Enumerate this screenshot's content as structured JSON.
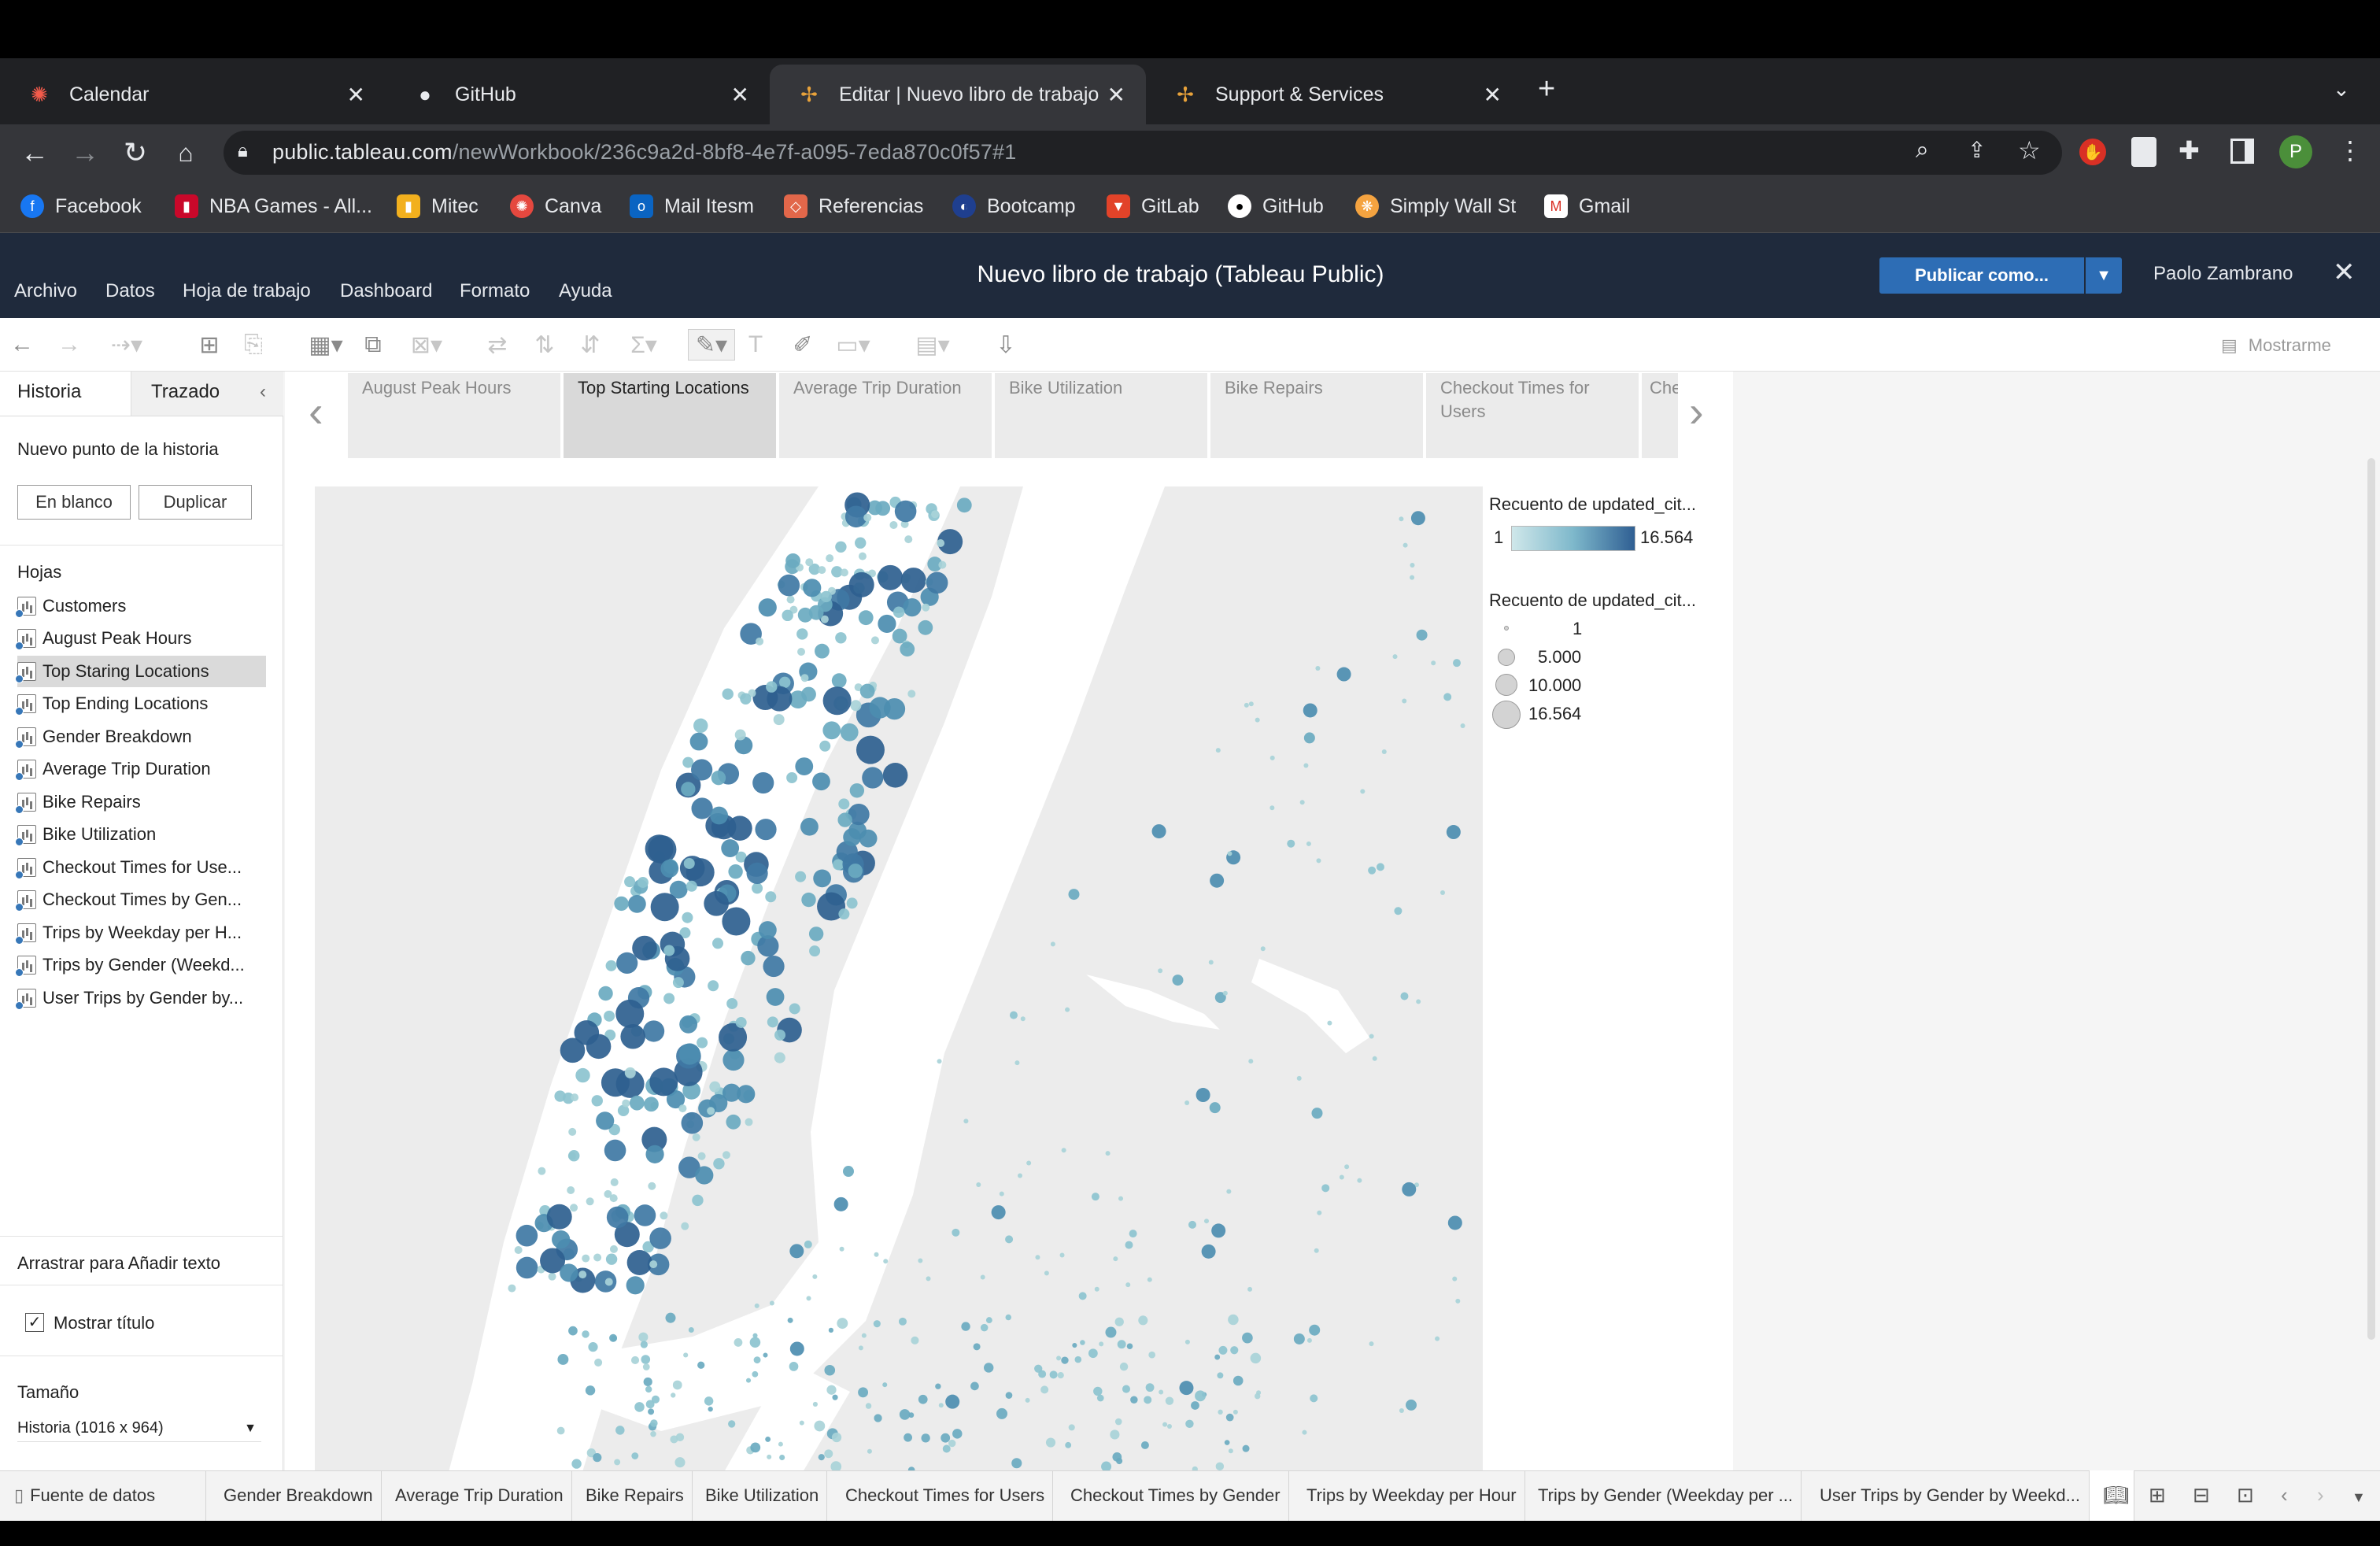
{
  "browser": {
    "tabs": [
      {
        "title": "Calendar",
        "icon": "calendar-icon"
      },
      {
        "title": "GitHub",
        "icon": "github-icon"
      },
      {
        "title": "Editar | Nuevo libro de trabajo",
        "icon": "tableau-icon"
      },
      {
        "title": "Support & Services",
        "icon": "tableau-icon"
      }
    ],
    "url_domain": "public.tableau.com",
    "url_path": "/newWorkbook/236c9a2d-8bf8-4e7f-a095-7eda870c0f57#1",
    "profile_initial": "P",
    "bookmarks": [
      "Facebook",
      "NBA Games - All...",
      "Mitec",
      "Canva",
      "Mail Itesm",
      "Referencias",
      "Bootcamp",
      "GitLab",
      "GitHub",
      "Simply Wall St",
      "Gmail"
    ]
  },
  "tableau": {
    "menu": [
      "Archivo",
      "Datos",
      "Hoja de trabajo",
      "Dashboard",
      "Formato",
      "Ayuda"
    ],
    "workbook_title": "Nuevo libro de trabajo (Tableau Public)",
    "publish_label": "Publicar como...",
    "user_name": "Paolo Zambrano",
    "show_me": "Mostrarme"
  },
  "left_panel": {
    "tab_history": "Historia",
    "tab_layout": "Trazado",
    "new_story_point": "Nuevo punto de la historia",
    "btn_blank": "En blanco",
    "btn_duplicate": "Duplicar",
    "sheets_header": "Hojas",
    "sheets": [
      "Customers",
      "August Peak Hours",
      "Top Staring Locations",
      "Top Ending Locations",
      "Gender Breakdown",
      "Average Trip Duration",
      "Bike Repairs",
      "Bike Utilization",
      "Checkout Times for Use...",
      "Checkout Times by Gen...",
      "Trips by Weekday per H...",
      "Trips by Gender (Weekd...",
      "User Trips by Gender by..."
    ],
    "selected_sheet": "Top Staring Locations",
    "drag_text": "Arrastrar para Añadir texto",
    "show_title": "Mostrar título",
    "size_header": "Tamaño",
    "size_value": "Historia (1016 x 964)"
  },
  "story_points": [
    "August Peak Hours",
    "Top Starting Locations",
    "Average Trip Duration",
    "Bike Utilization",
    "Bike Repairs",
    "Checkout Times for Users",
    "Checkout Times by Gender"
  ],
  "selected_story_point": "Top Starting Locations",
  "legend": {
    "color_title": "Recuento de updated_cit...",
    "color_min": "1",
    "color_max": "16.564",
    "size_title": "Recuento de updated_cit...",
    "size_values": [
      "1",
      "5.000",
      "10.000",
      "16.564"
    ],
    "color_low": "#cfe7ea",
    "color_high": "#2f5f93"
  },
  "bottom_tabs": {
    "data_source": "Fuente de datos",
    "tabs": [
      "Gender Breakdown",
      "Average Trip Duration",
      "Bike Repairs",
      "Bike Utilization",
      "Checkout Times for Users",
      "Checkout Times by Gender",
      "Trips by Weekday per Hour",
      "Trips by Gender (Weekday per ...",
      "User Trips by Gender by Weekd..."
    ]
  },
  "icons": {
    "back": "back-arrow-icon",
    "forward": "forward-arrow-icon",
    "reload": "reload-icon",
    "home": "home-icon",
    "lock": "lock-icon",
    "zoom": "zoom-icon",
    "share": "share-icon",
    "star": "star-icon",
    "extension": "puzzle-icon"
  }
}
